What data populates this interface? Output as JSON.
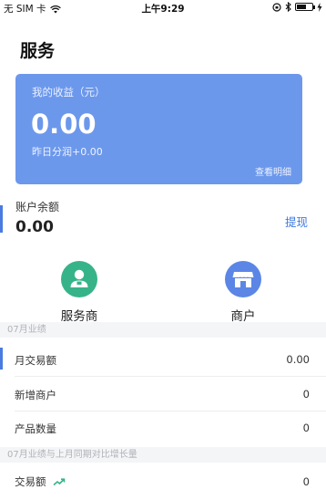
{
  "status_bar": {
    "carrier": "无 SIM 卡",
    "time": "上午9:29"
  },
  "header": {
    "title": "服务"
  },
  "earnings_card": {
    "label": "我的收益（元）",
    "amount": "0.00",
    "yesterday": "昨日分润+0.00",
    "detail_link": "查看明细"
  },
  "balance": {
    "label": "账户余额",
    "value": "0.00",
    "withdraw": "提现"
  },
  "roles": [
    {
      "name": "服务商",
      "icon": "service-provider-icon",
      "color": "#37b389"
    },
    {
      "name": "商户",
      "icon": "storefront-icon",
      "color": "#5b86e6"
    }
  ],
  "section_month": {
    "title": "07月业绩"
  },
  "month_stats": [
    {
      "label": "月交易额",
      "value": "0.00"
    },
    {
      "label": "新增商户",
      "value": "0"
    },
    {
      "label": "产品数量",
      "value": "0"
    }
  ],
  "section_compare": {
    "title": "07月业绩与上月同期对比增长量"
  },
  "compare_stats": [
    {
      "label": "交易额",
      "value": "0",
      "icon": "trend-up-icon"
    }
  ],
  "colors": {
    "accent": "#6c98ec",
    "link": "#3e78e0",
    "indicator": "#4a7be0"
  }
}
